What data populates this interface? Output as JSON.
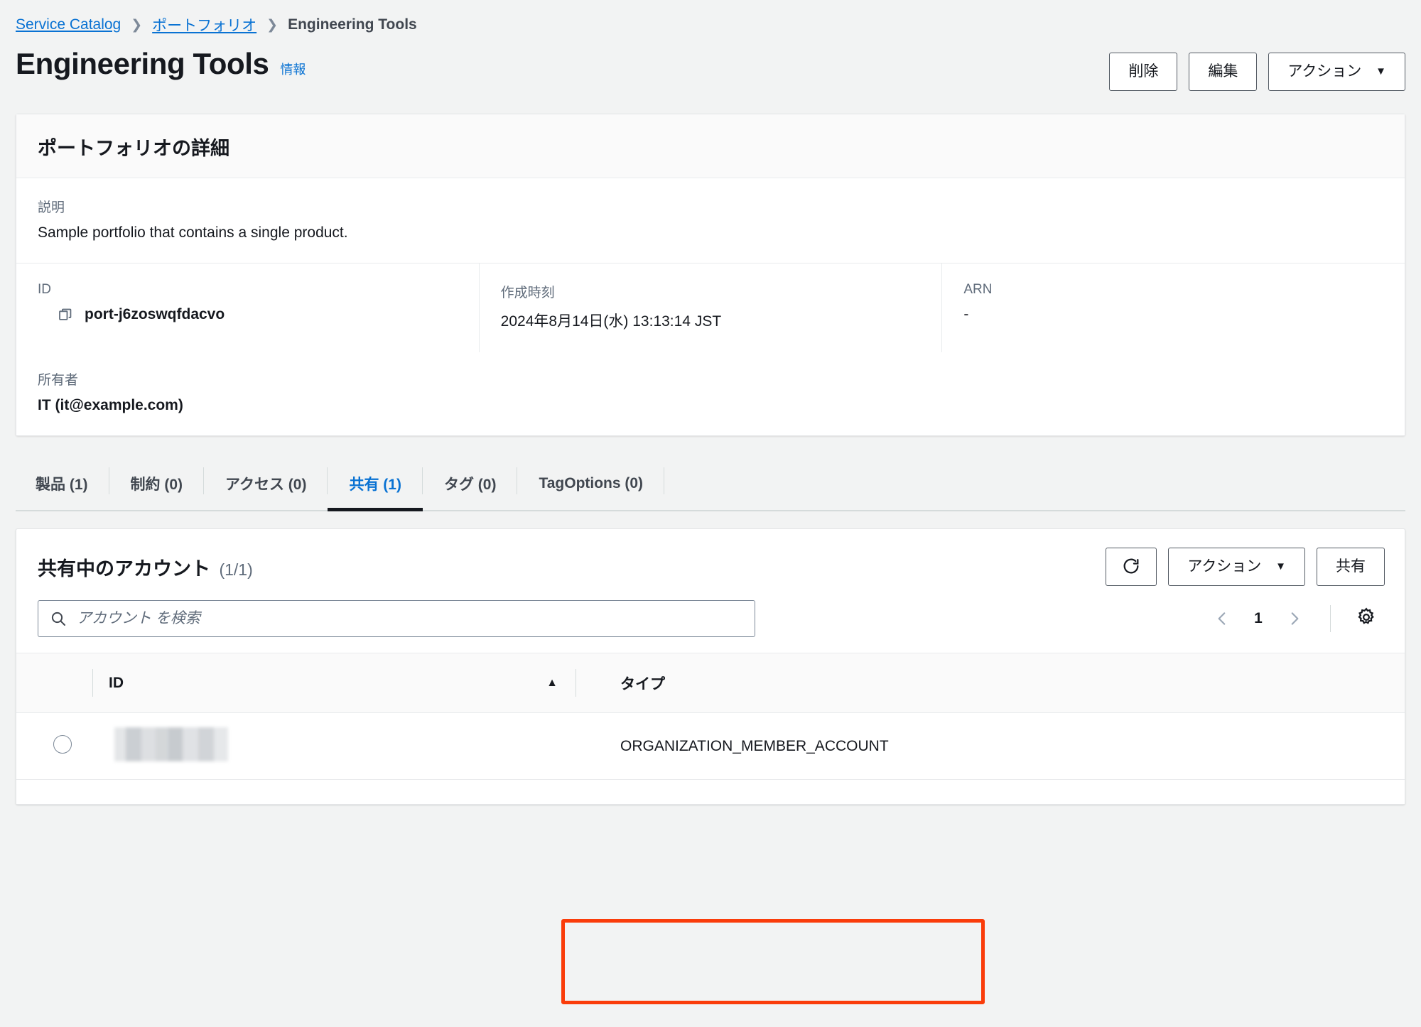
{
  "breadcrumb": {
    "items": [
      {
        "label": "Service Catalog",
        "type": "link"
      },
      {
        "label": "ポートフォリオ",
        "type": "link"
      },
      {
        "label": "Engineering Tools",
        "type": "current"
      }
    ],
    "separator": "❯"
  },
  "header": {
    "title": "Engineering Tools",
    "info_label": "情報",
    "buttons": {
      "delete": "削除",
      "edit": "編集",
      "actions": "アクション",
      "caret": "▼"
    }
  },
  "details_card": {
    "heading": "ポートフォリオの詳細",
    "description": {
      "label": "説明",
      "value": "Sample portfolio that contains a single product."
    },
    "id": {
      "label": "ID",
      "value": "port-j6zoswqfdacvo",
      "icon": "copy-icon"
    },
    "created_time": {
      "label": "作成時刻",
      "value": "2024年8月14日(水) 13:13:14 JST"
    },
    "arn": {
      "label": "ARN",
      "value": "-"
    },
    "owner": {
      "label": "所有者",
      "value": "IT (it@example.com)"
    }
  },
  "tabs": [
    {
      "label": "製品 (1)",
      "active": false
    },
    {
      "label": "制約 (0)",
      "active": false
    },
    {
      "label": "アクセス (0)",
      "active": false
    },
    {
      "label": "共有 (1)",
      "active": true
    },
    {
      "label": "タグ (0)",
      "active": false
    },
    {
      "label": "TagOptions (0)",
      "active": false
    }
  ],
  "shares_panel": {
    "title": "共有中のアカウント",
    "count": "(1/1)",
    "buttons": {
      "refresh_icon": "refresh-icon",
      "actions": "アクション",
      "caret": "▼",
      "share": "共有"
    },
    "search": {
      "placeholder": "アカウント を検索",
      "value": "",
      "icon": "search-icon"
    },
    "pagination": {
      "prev_icon": "chevron-left-icon",
      "page": "1",
      "next_icon": "chevron-right-icon",
      "settings_icon": "gear-icon"
    },
    "table": {
      "columns": [
        {
          "key": "select",
          "label": ""
        },
        {
          "key": "id",
          "label": "ID",
          "sorted": "asc",
          "sort_caret": "▲"
        },
        {
          "key": "type",
          "label": "タイプ"
        }
      ],
      "rows": [
        {
          "selected": false,
          "id": "",
          "id_redacted": true,
          "type": "ORGANIZATION_MEMBER_ACCOUNT"
        }
      ]
    }
  },
  "annotation": {
    "color": "#fa3c0a",
    "target": "ORGANIZATION_MEMBER_ACCOUNT"
  }
}
